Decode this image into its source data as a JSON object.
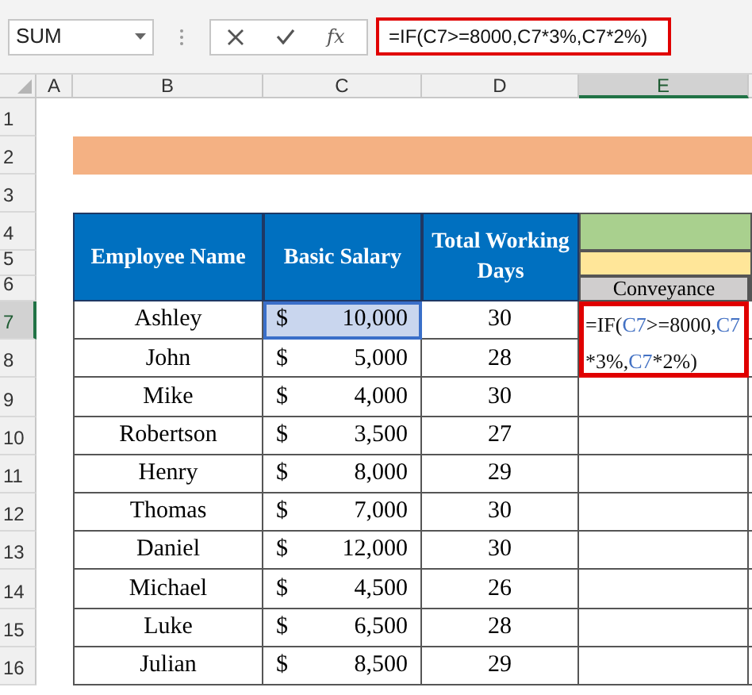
{
  "formula_bar": {
    "name_box": "SUM",
    "fx": "fx",
    "formula": "=IF(C7>=8000,C7*3%,C7*2%)"
  },
  "column_headers": [
    {
      "label": "A",
      "selected": false
    },
    {
      "label": "B",
      "selected": false
    },
    {
      "label": "C",
      "selected": false
    },
    {
      "label": "D",
      "selected": false
    },
    {
      "label": "E",
      "selected": true
    }
  ],
  "row_headers": [
    {
      "label": "1",
      "selected": false
    },
    {
      "label": "2",
      "selected": false
    },
    {
      "label": "3",
      "selected": false
    },
    {
      "label": "4",
      "selected": false
    },
    {
      "label": "5",
      "selected": false
    },
    {
      "label": "6",
      "selected": false
    },
    {
      "label": "7",
      "selected": true
    },
    {
      "label": "8",
      "selected": false
    },
    {
      "label": "9",
      "selected": false
    },
    {
      "label": "10",
      "selected": false
    },
    {
      "label": "11",
      "selected": false
    },
    {
      "label": "12",
      "selected": false
    },
    {
      "label": "13",
      "selected": false
    },
    {
      "label": "14",
      "selected": false
    },
    {
      "label": "15",
      "selected": false
    },
    {
      "label": "16",
      "selected": false
    }
  ],
  "table": {
    "columns": [
      "Employee Name",
      "Basic Salary",
      "Total Working Days"
    ],
    "column_4": "Conveyance",
    "rows": [
      {
        "name": "Ashley",
        "currency": "$",
        "salary": "10,000",
        "days": "30",
        "selected": true
      },
      {
        "name": "John",
        "currency": "$",
        "salary": "5,000",
        "days": "28",
        "selected": false
      },
      {
        "name": "Mike",
        "currency": "$",
        "salary": "4,000",
        "days": "30",
        "selected": false
      },
      {
        "name": "Robertson",
        "currency": "$",
        "salary": "3,500",
        "days": "27",
        "selected": false
      },
      {
        "name": "Henry",
        "currency": "$",
        "salary": "8,000",
        "days": "29",
        "selected": false
      },
      {
        "name": "Thomas",
        "currency": "$",
        "salary": "7,000",
        "days": "30",
        "selected": false
      },
      {
        "name": "Daniel",
        "currency": "$",
        "salary": "12,000",
        "days": "30",
        "selected": false
      },
      {
        "name": "Michael",
        "currency": "$",
        "salary": "4,500",
        "days": "26",
        "selected": false
      },
      {
        "name": "Luke",
        "currency": "$",
        "salary": "6,500",
        "days": "28",
        "selected": false
      },
      {
        "name": "Julian",
        "currency": "$",
        "salary": "8,500",
        "days": "29",
        "selected": false
      }
    ]
  },
  "editing_cell": {
    "parts": [
      {
        "kind": "plain",
        "text": "=IF("
      },
      {
        "kind": "ref",
        "text": "C7"
      },
      {
        "kind": "plain",
        "text": ">=8000,"
      },
      {
        "kind": "ref",
        "text": "C7"
      },
      {
        "kind": "plain",
        "text": "*3%,"
      },
      {
        "kind": "ref",
        "text": "C7"
      },
      {
        "kind": "plain",
        "text": "*2%)"
      }
    ]
  }
}
